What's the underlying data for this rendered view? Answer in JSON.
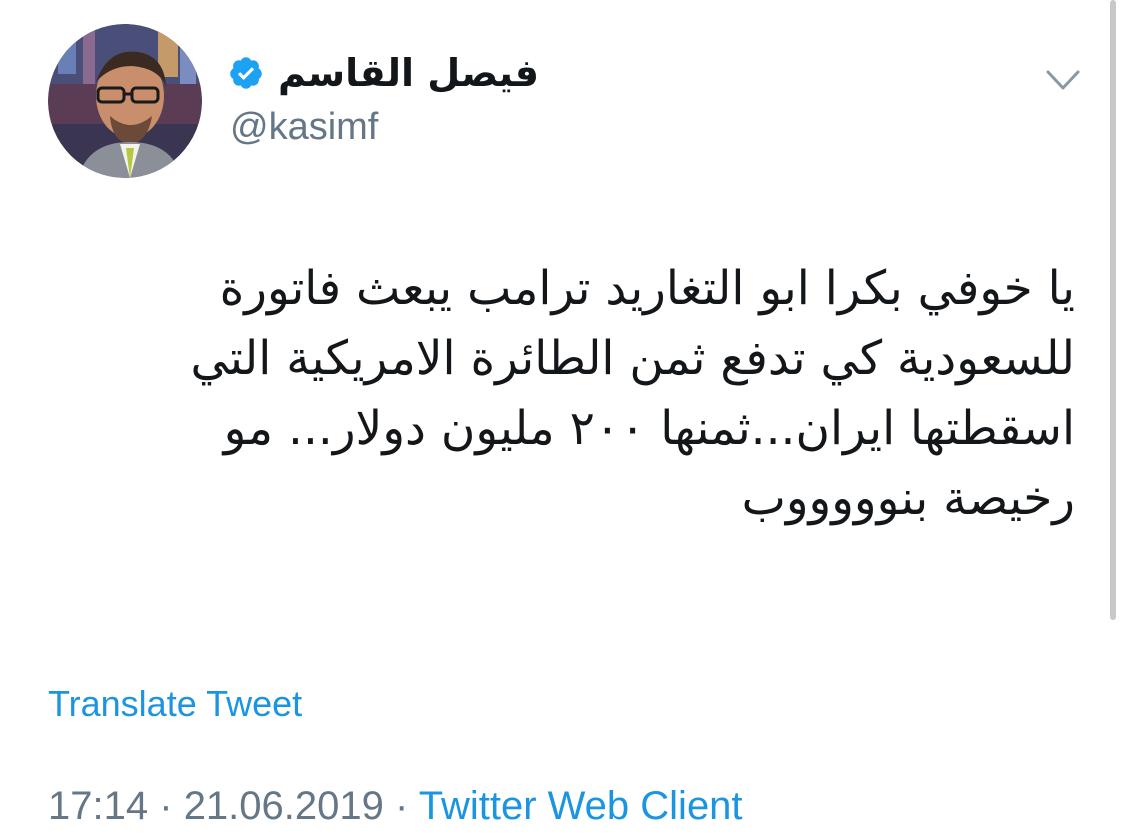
{
  "user": {
    "display_name": "فيصل القاسم",
    "handle": "@kasimf",
    "verified": true,
    "avatar_icon": "profile-photo"
  },
  "tweet": {
    "lines": [
      "يا خوفي بكرا ابو التغاريد ترامب يبعث فاتورة",
      "للسعودية كي تدفع ثمن الطائرة الامريكية التي",
      "اسقطتها ايران...ثمنها ٢٠٠ مليون دولار... مو",
      "رخيصة بنوووووب"
    ],
    "translate_label": "Translate Tweet",
    "time": "17:14",
    "separator": "·",
    "date": "21.06.2019",
    "source": "Twitter Web Client"
  },
  "icons": {
    "verified": "verified-badge-icon",
    "menu": "chevron-down-icon"
  },
  "colors": {
    "link_blue": "#1b95e0",
    "verified_blue": "#1da1f2",
    "secondary_text": "#657786",
    "primary_text": "#14171a"
  }
}
